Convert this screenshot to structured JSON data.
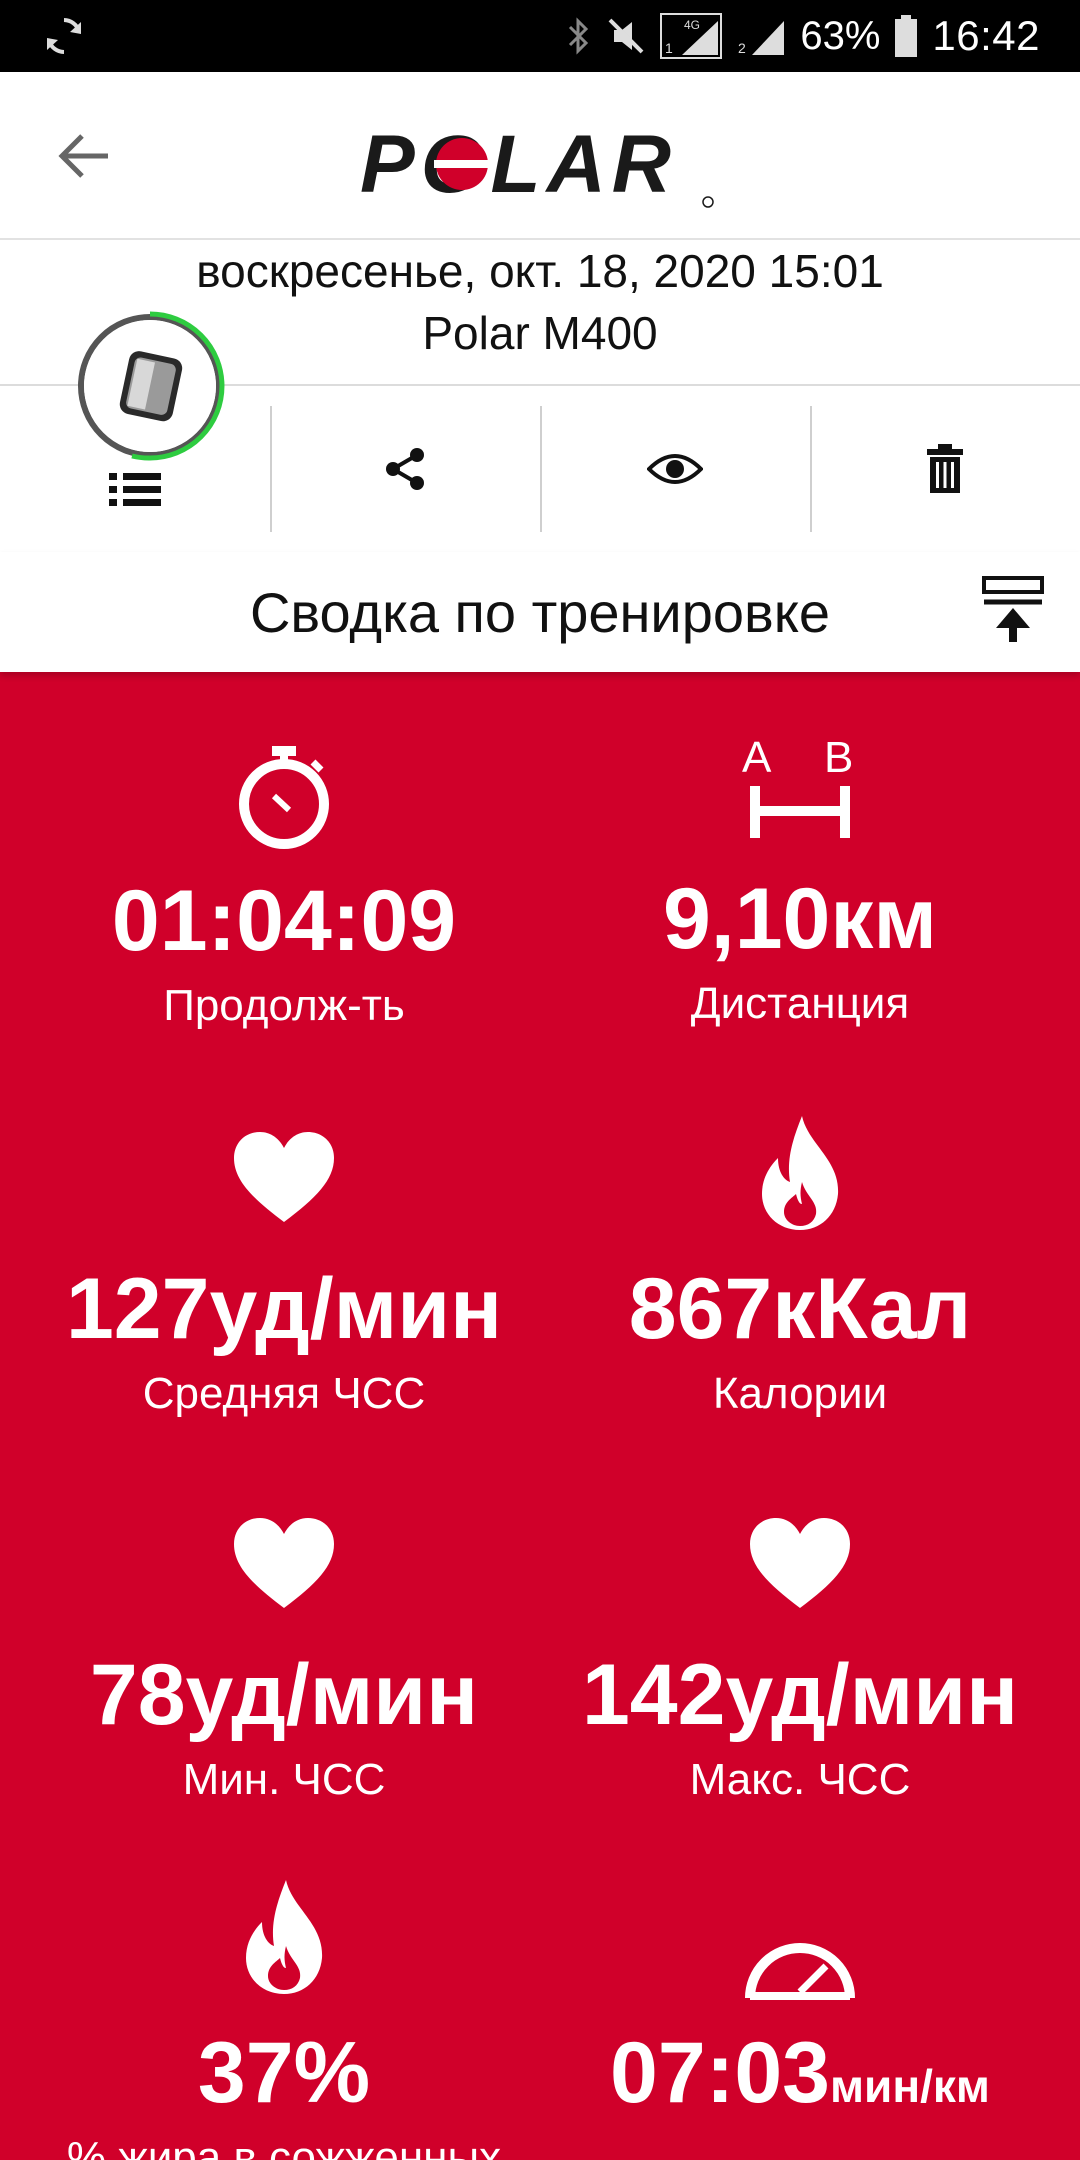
{
  "status_bar": {
    "battery_percent": "63%",
    "time": "16:42",
    "network_label": "4G",
    "sim1": "1",
    "sim2": "2"
  },
  "app_bar": {
    "brand": "POLAR"
  },
  "session": {
    "date": "воскресенье, окт. 18, 2020 15:01",
    "device": "Polar M400"
  },
  "toolbar": {
    "items": [
      "list-icon",
      "share-icon",
      "eye-icon",
      "trash-icon"
    ]
  },
  "section": {
    "title": "Сводка по тренировке"
  },
  "stats": [
    {
      "icon": "stopwatch-icon",
      "value": "01:04:09",
      "label": "Продолж-ть"
    },
    {
      "icon": "distance-icon",
      "icon_a": "A",
      "icon_b": "B",
      "value": "9,10км",
      "label": "Дистанция"
    },
    {
      "icon": "heart-icon",
      "value": "127уд/мин",
      "label": "Средняя ЧСС"
    },
    {
      "icon": "flame-icon",
      "value": "867кКал",
      "label": "Калории"
    },
    {
      "icon": "heart-icon",
      "value": "78уд/мин",
      "label": "Мин. ЧСС"
    },
    {
      "icon": "heart-icon",
      "value": "142уд/мин",
      "label": "Макс. ЧСС"
    },
    {
      "icon": "flame-icon",
      "value": "37%",
      "label": "% жира в сожженных"
    },
    {
      "icon": "speedometer-icon",
      "value": "07:03",
      "unit": "мин/км",
      "label": ""
    }
  ],
  "colors": {
    "accent_red": "#d0002a",
    "ring_green": "#2ecc40"
  }
}
